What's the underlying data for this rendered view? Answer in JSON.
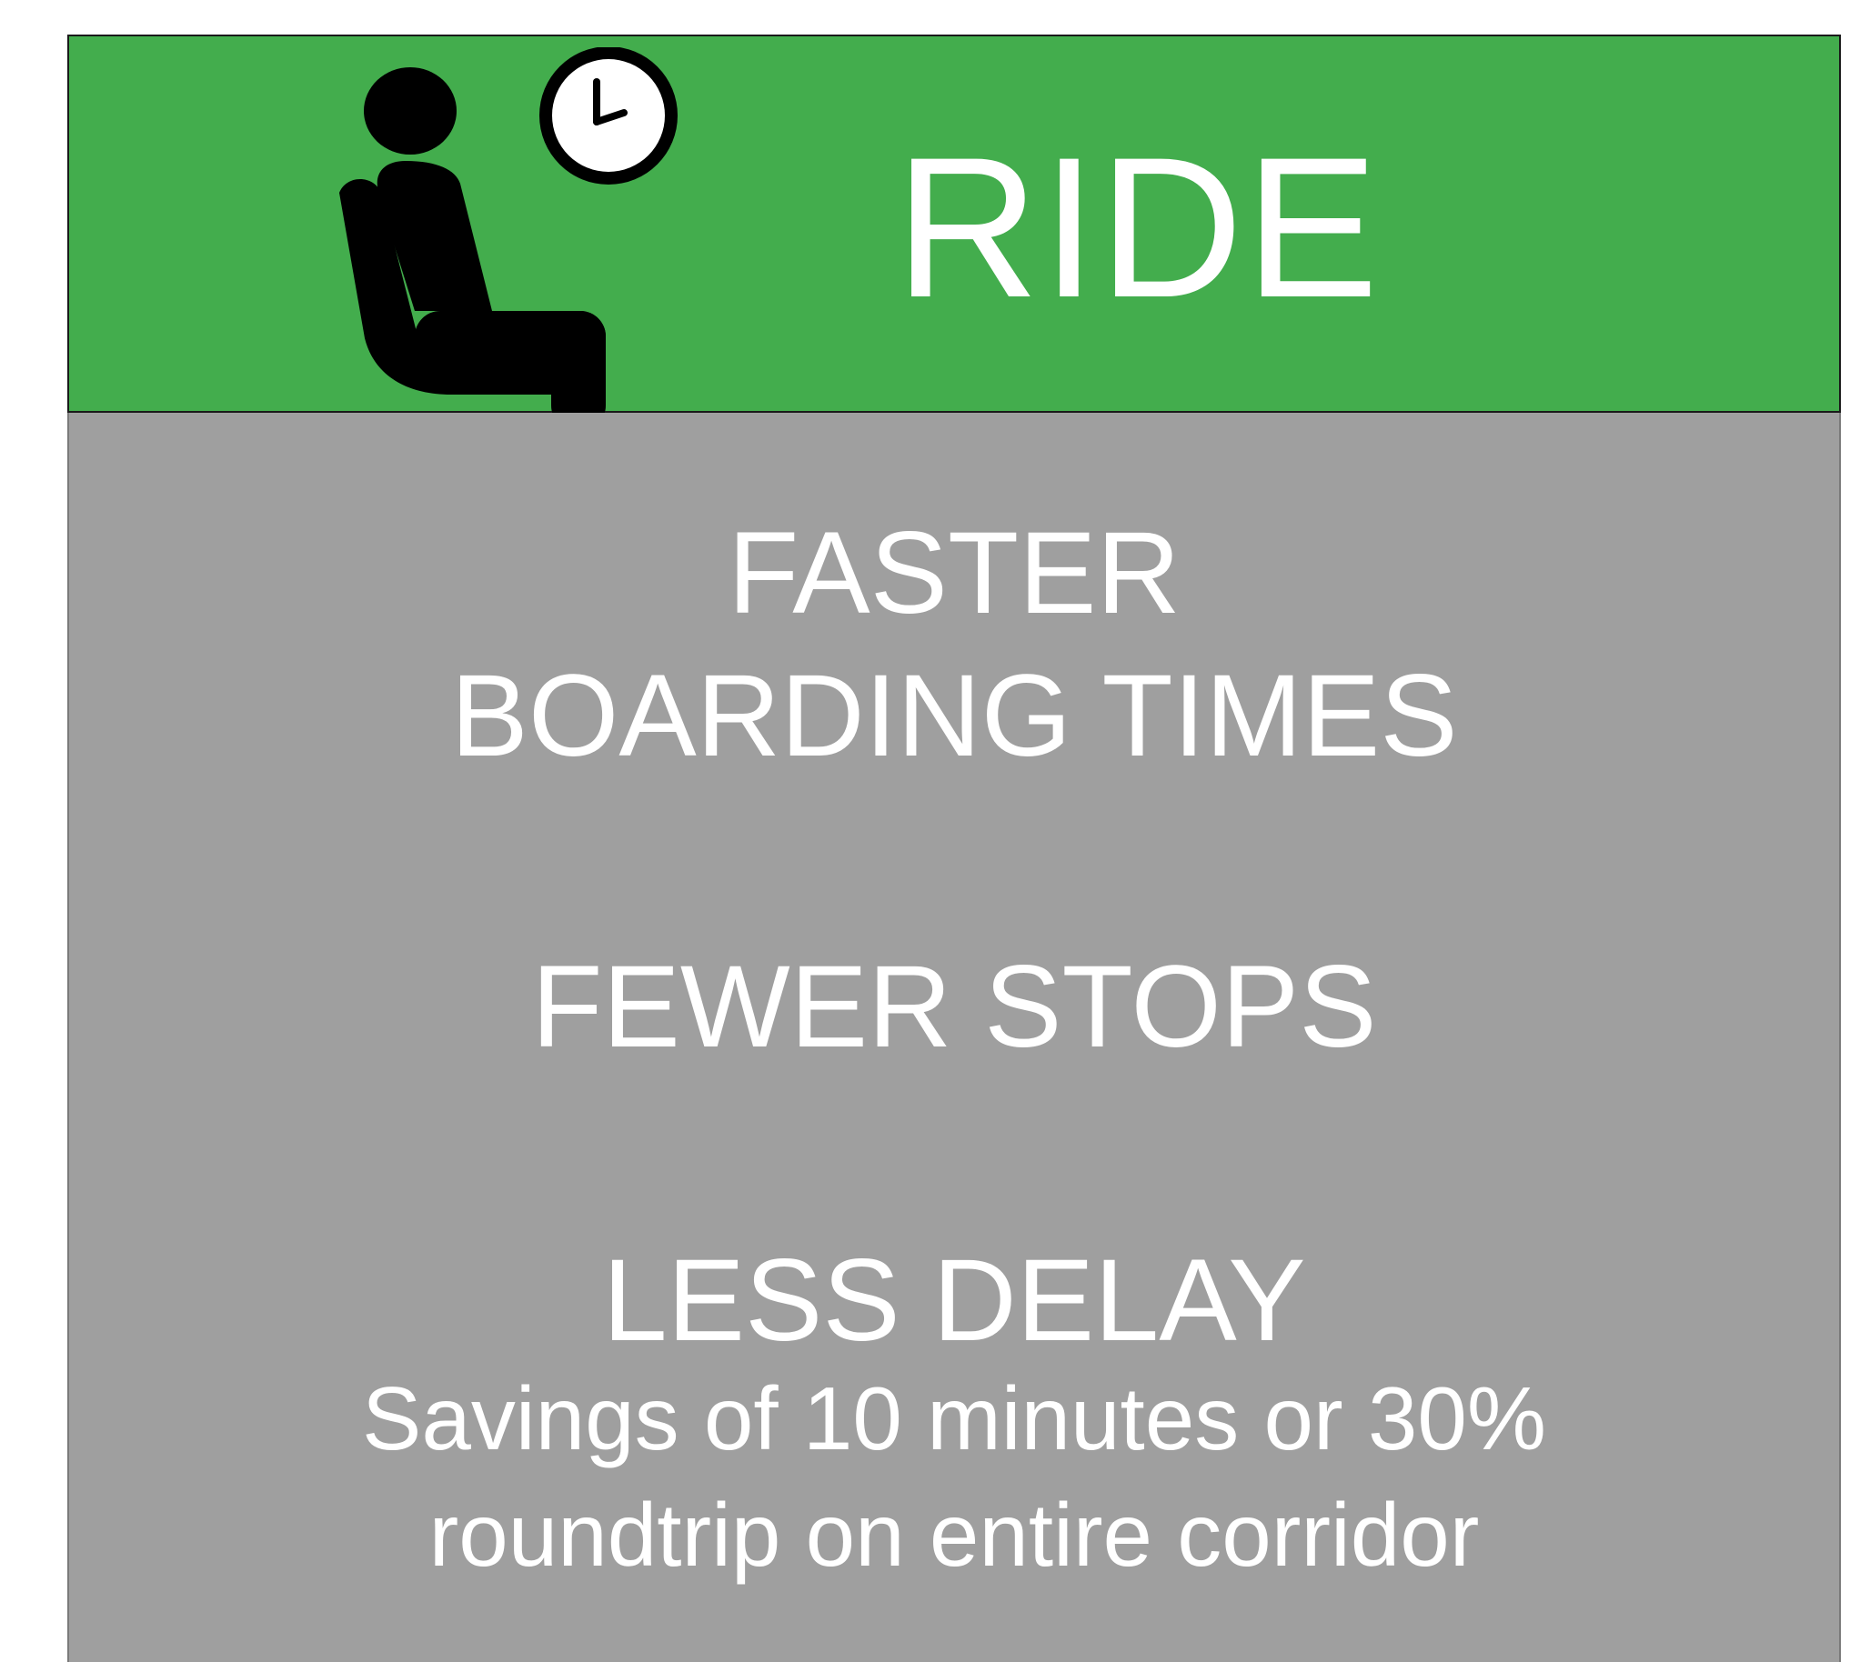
{
  "header": {
    "title": "RIDE",
    "background_color": "#43ad4d",
    "icons": [
      "seated-person-icon",
      "clock-icon"
    ]
  },
  "body": {
    "background_color": "#9f9f9f",
    "text_color": "#ffffff",
    "lines": [
      "FASTER",
      "BOARDING TIMES",
      "FEWER STOPS",
      "LESS DELAY",
      "Savings of 10 minutes or 30%",
      "roundtrip on entire corridor"
    ]
  }
}
